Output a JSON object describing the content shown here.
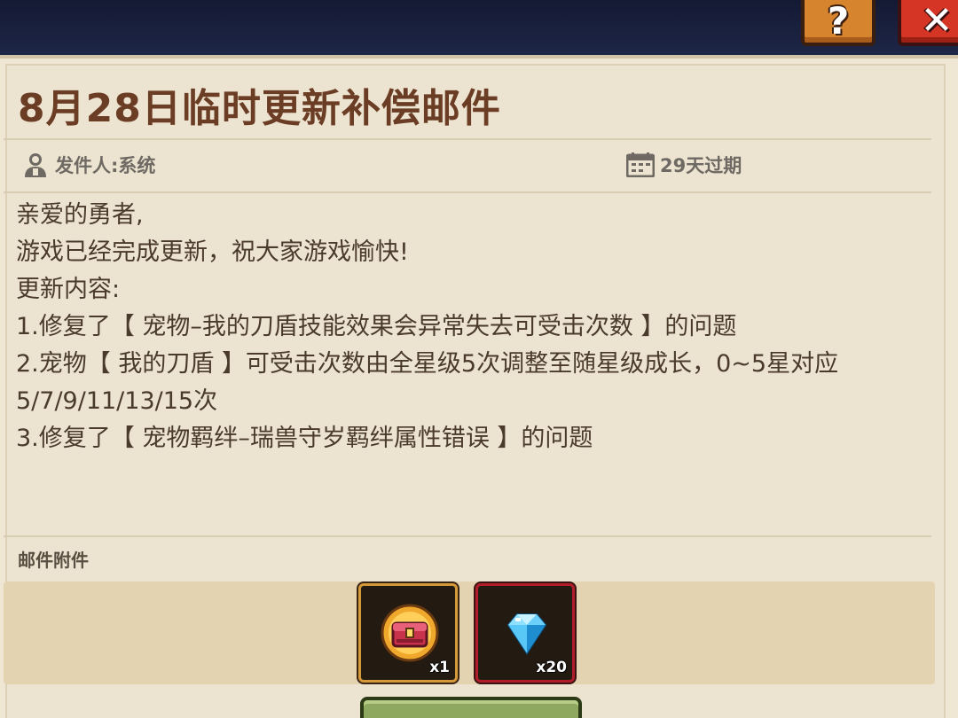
{
  "mail": {
    "title": "8月28日临时更新补偿邮件",
    "sender": "发件人:系统",
    "expiry": "29天过期",
    "body_lines": [
      "亲爱的勇者,",
      "游戏已经完成更新，祝大家游戏愉快!",
      "更新内容:",
      "1.修复了【 宠物–我的刀盾技能效果会异常失去可受击次数 】的问题",
      "2.宠物【 我的刀盾 】可受击次数由全星级5次调整至随星级成长，0~5星对应",
      "5/7/9/11/13/15次",
      "3.修复了【 宠物羁绊–瑞兽守岁羁绊属性错误 】的问题"
    ],
    "attachments_label": "邮件附件",
    "attachments": [
      {
        "icon": "treasure-chest-icon",
        "qty": "x1",
        "frame": "gold"
      },
      {
        "icon": "blue-gem-icon",
        "qty": "x20",
        "frame": "red"
      }
    ]
  },
  "controls": {
    "help_glyph": "?",
    "close_glyph": "✕"
  },
  "colors": {
    "parchment": "#ece3d0",
    "title": "#6b3d24",
    "body_text": "#4a3a2c",
    "help_button": "#d7842f",
    "close_button": "#d53524",
    "claim_button": "#8fa860"
  }
}
